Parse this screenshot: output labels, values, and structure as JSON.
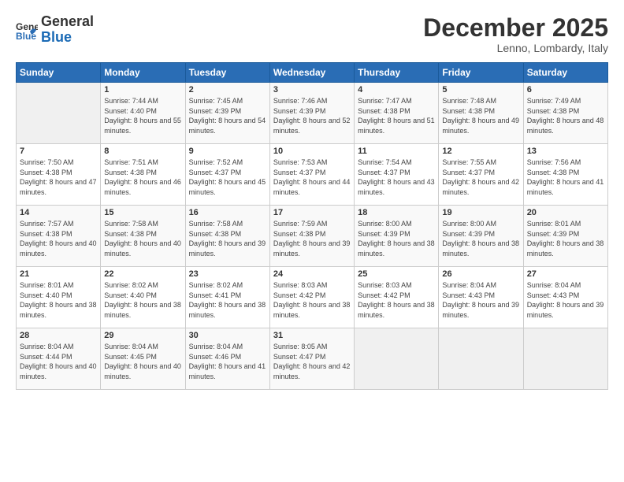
{
  "logo": {
    "line1": "General",
    "line2": "Blue"
  },
  "header": {
    "month": "December 2025",
    "location": "Lenno, Lombardy, Italy"
  },
  "weekdays": [
    "Sunday",
    "Monday",
    "Tuesday",
    "Wednesday",
    "Thursday",
    "Friday",
    "Saturday"
  ],
  "weeks": [
    [
      {
        "day": "",
        "sunrise": "",
        "sunset": "",
        "daylight": ""
      },
      {
        "day": "1",
        "sunrise": "Sunrise: 7:44 AM",
        "sunset": "Sunset: 4:40 PM",
        "daylight": "Daylight: 8 hours and 55 minutes."
      },
      {
        "day": "2",
        "sunrise": "Sunrise: 7:45 AM",
        "sunset": "Sunset: 4:39 PM",
        "daylight": "Daylight: 8 hours and 54 minutes."
      },
      {
        "day": "3",
        "sunrise": "Sunrise: 7:46 AM",
        "sunset": "Sunset: 4:39 PM",
        "daylight": "Daylight: 8 hours and 52 minutes."
      },
      {
        "day": "4",
        "sunrise": "Sunrise: 7:47 AM",
        "sunset": "Sunset: 4:38 PM",
        "daylight": "Daylight: 8 hours and 51 minutes."
      },
      {
        "day": "5",
        "sunrise": "Sunrise: 7:48 AM",
        "sunset": "Sunset: 4:38 PM",
        "daylight": "Daylight: 8 hours and 49 minutes."
      },
      {
        "day": "6",
        "sunrise": "Sunrise: 7:49 AM",
        "sunset": "Sunset: 4:38 PM",
        "daylight": "Daylight: 8 hours and 48 minutes."
      }
    ],
    [
      {
        "day": "7",
        "sunrise": "Sunrise: 7:50 AM",
        "sunset": "Sunset: 4:38 PM",
        "daylight": "Daylight: 8 hours and 47 minutes."
      },
      {
        "day": "8",
        "sunrise": "Sunrise: 7:51 AM",
        "sunset": "Sunset: 4:38 PM",
        "daylight": "Daylight: 8 hours and 46 minutes."
      },
      {
        "day": "9",
        "sunrise": "Sunrise: 7:52 AM",
        "sunset": "Sunset: 4:37 PM",
        "daylight": "Daylight: 8 hours and 45 minutes."
      },
      {
        "day": "10",
        "sunrise": "Sunrise: 7:53 AM",
        "sunset": "Sunset: 4:37 PM",
        "daylight": "Daylight: 8 hours and 44 minutes."
      },
      {
        "day": "11",
        "sunrise": "Sunrise: 7:54 AM",
        "sunset": "Sunset: 4:37 PM",
        "daylight": "Daylight: 8 hours and 43 minutes."
      },
      {
        "day": "12",
        "sunrise": "Sunrise: 7:55 AM",
        "sunset": "Sunset: 4:37 PM",
        "daylight": "Daylight: 8 hours and 42 minutes."
      },
      {
        "day": "13",
        "sunrise": "Sunrise: 7:56 AM",
        "sunset": "Sunset: 4:38 PM",
        "daylight": "Daylight: 8 hours and 41 minutes."
      }
    ],
    [
      {
        "day": "14",
        "sunrise": "Sunrise: 7:57 AM",
        "sunset": "Sunset: 4:38 PM",
        "daylight": "Daylight: 8 hours and 40 minutes."
      },
      {
        "day": "15",
        "sunrise": "Sunrise: 7:58 AM",
        "sunset": "Sunset: 4:38 PM",
        "daylight": "Daylight: 8 hours and 40 minutes."
      },
      {
        "day": "16",
        "sunrise": "Sunrise: 7:58 AM",
        "sunset": "Sunset: 4:38 PM",
        "daylight": "Daylight: 8 hours and 39 minutes."
      },
      {
        "day": "17",
        "sunrise": "Sunrise: 7:59 AM",
        "sunset": "Sunset: 4:38 PM",
        "daylight": "Daylight: 8 hours and 39 minutes."
      },
      {
        "day": "18",
        "sunrise": "Sunrise: 8:00 AM",
        "sunset": "Sunset: 4:39 PM",
        "daylight": "Daylight: 8 hours and 38 minutes."
      },
      {
        "day": "19",
        "sunrise": "Sunrise: 8:00 AM",
        "sunset": "Sunset: 4:39 PM",
        "daylight": "Daylight: 8 hours and 38 minutes."
      },
      {
        "day": "20",
        "sunrise": "Sunrise: 8:01 AM",
        "sunset": "Sunset: 4:39 PM",
        "daylight": "Daylight: 8 hours and 38 minutes."
      }
    ],
    [
      {
        "day": "21",
        "sunrise": "Sunrise: 8:01 AM",
        "sunset": "Sunset: 4:40 PM",
        "daylight": "Daylight: 8 hours and 38 minutes."
      },
      {
        "day": "22",
        "sunrise": "Sunrise: 8:02 AM",
        "sunset": "Sunset: 4:40 PM",
        "daylight": "Daylight: 8 hours and 38 minutes."
      },
      {
        "day": "23",
        "sunrise": "Sunrise: 8:02 AM",
        "sunset": "Sunset: 4:41 PM",
        "daylight": "Daylight: 8 hours and 38 minutes."
      },
      {
        "day": "24",
        "sunrise": "Sunrise: 8:03 AM",
        "sunset": "Sunset: 4:42 PM",
        "daylight": "Daylight: 8 hours and 38 minutes."
      },
      {
        "day": "25",
        "sunrise": "Sunrise: 8:03 AM",
        "sunset": "Sunset: 4:42 PM",
        "daylight": "Daylight: 8 hours and 38 minutes."
      },
      {
        "day": "26",
        "sunrise": "Sunrise: 8:04 AM",
        "sunset": "Sunset: 4:43 PM",
        "daylight": "Daylight: 8 hours and 39 minutes."
      },
      {
        "day": "27",
        "sunrise": "Sunrise: 8:04 AM",
        "sunset": "Sunset: 4:43 PM",
        "daylight": "Daylight: 8 hours and 39 minutes."
      }
    ],
    [
      {
        "day": "28",
        "sunrise": "Sunrise: 8:04 AM",
        "sunset": "Sunset: 4:44 PM",
        "daylight": "Daylight: 8 hours and 40 minutes."
      },
      {
        "day": "29",
        "sunrise": "Sunrise: 8:04 AM",
        "sunset": "Sunset: 4:45 PM",
        "daylight": "Daylight: 8 hours and 40 minutes."
      },
      {
        "day": "30",
        "sunrise": "Sunrise: 8:04 AM",
        "sunset": "Sunset: 4:46 PM",
        "daylight": "Daylight: 8 hours and 41 minutes."
      },
      {
        "day": "31",
        "sunrise": "Sunrise: 8:05 AM",
        "sunset": "Sunset: 4:47 PM",
        "daylight": "Daylight: 8 hours and 42 minutes."
      },
      {
        "day": "",
        "sunrise": "",
        "sunset": "",
        "daylight": ""
      },
      {
        "day": "",
        "sunrise": "",
        "sunset": "",
        "daylight": ""
      },
      {
        "day": "",
        "sunrise": "",
        "sunset": "",
        "daylight": ""
      }
    ]
  ]
}
